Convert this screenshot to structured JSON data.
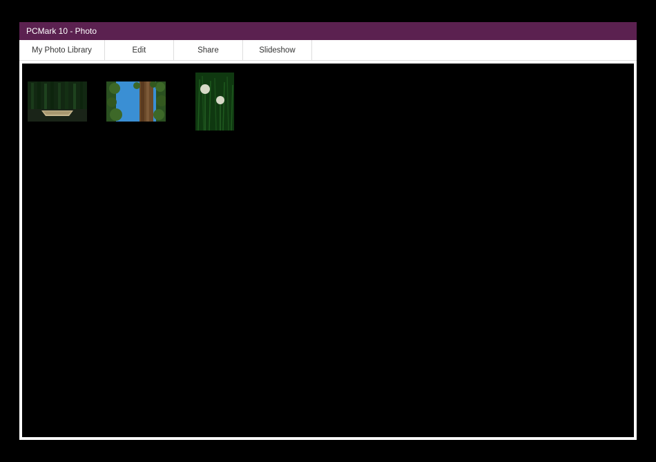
{
  "window": {
    "title": "PCMark 10 - Photo"
  },
  "toolbar": {
    "items": [
      {
        "label": "My Photo Library"
      },
      {
        "label": "Edit"
      },
      {
        "label": "Share"
      },
      {
        "label": "Slideshow"
      }
    ]
  },
  "gallery": {
    "thumbnails": [
      {
        "name": "photo-forest-boat",
        "orientation": "landscape"
      },
      {
        "name": "photo-tree-sky",
        "orientation": "landscape"
      },
      {
        "name": "photo-dandelion-grass",
        "orientation": "portrait"
      }
    ]
  }
}
